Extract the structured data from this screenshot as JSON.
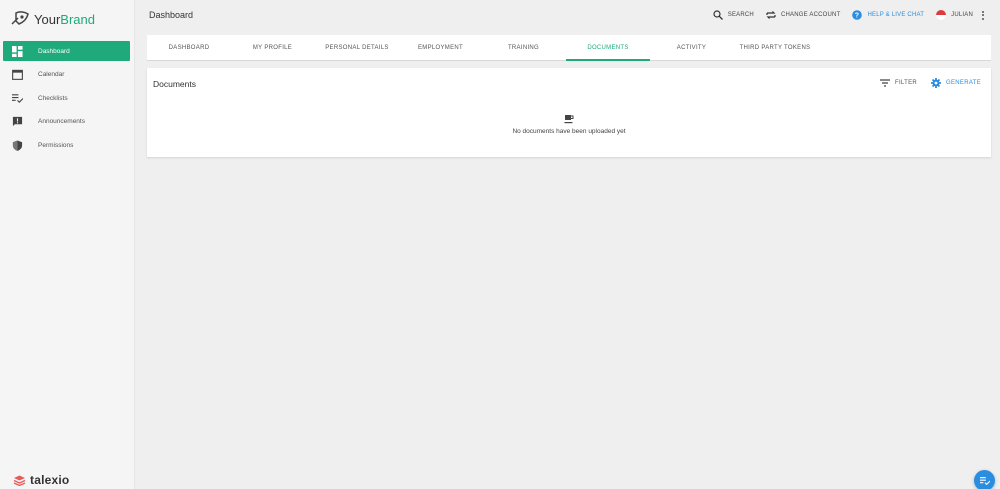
{
  "brand": {
    "name_part1": "Your",
    "name_part2": "Brand",
    "footer_logo": "talexio"
  },
  "sidebar": {
    "items": [
      {
        "label": "Dashboard",
        "icon": "dashboard-icon",
        "active": true
      },
      {
        "label": "Calendar",
        "icon": "calendar-icon",
        "active": false
      },
      {
        "label": "Checklists",
        "icon": "checklist-icon",
        "active": false
      },
      {
        "label": "Announcements",
        "icon": "announcement-icon",
        "active": false
      },
      {
        "label": "Permissions",
        "icon": "shield-icon",
        "active": false
      }
    ]
  },
  "header": {
    "title": "Dashboard",
    "search_label": "SEARCH",
    "change_account_label": "CHANGE ACCOUNT",
    "help_label": "HELP & LIVE CHAT",
    "user_label": "JULIAN"
  },
  "tabs": [
    {
      "label": "DASHBOARD",
      "active": false
    },
    {
      "label": "MY PROFILE",
      "active": false
    },
    {
      "label": "PERSONAL DETAILS",
      "active": false
    },
    {
      "label": "EMPLOYMENT",
      "active": false
    },
    {
      "label": "TRAINING",
      "active": false
    },
    {
      "label": "DOCUMENTS",
      "active": true
    },
    {
      "label": "ACTIVITY",
      "active": false
    },
    {
      "label": "THIRD PARTY TOKENS",
      "active": false
    }
  ],
  "documents_card": {
    "title": "Documents",
    "filter_label": "FILTER",
    "generate_label": "GENERATE",
    "empty_message": "No documents have been uploaded yet"
  },
  "colors": {
    "accent": "#1eaa7a",
    "link": "#2a8de0"
  }
}
